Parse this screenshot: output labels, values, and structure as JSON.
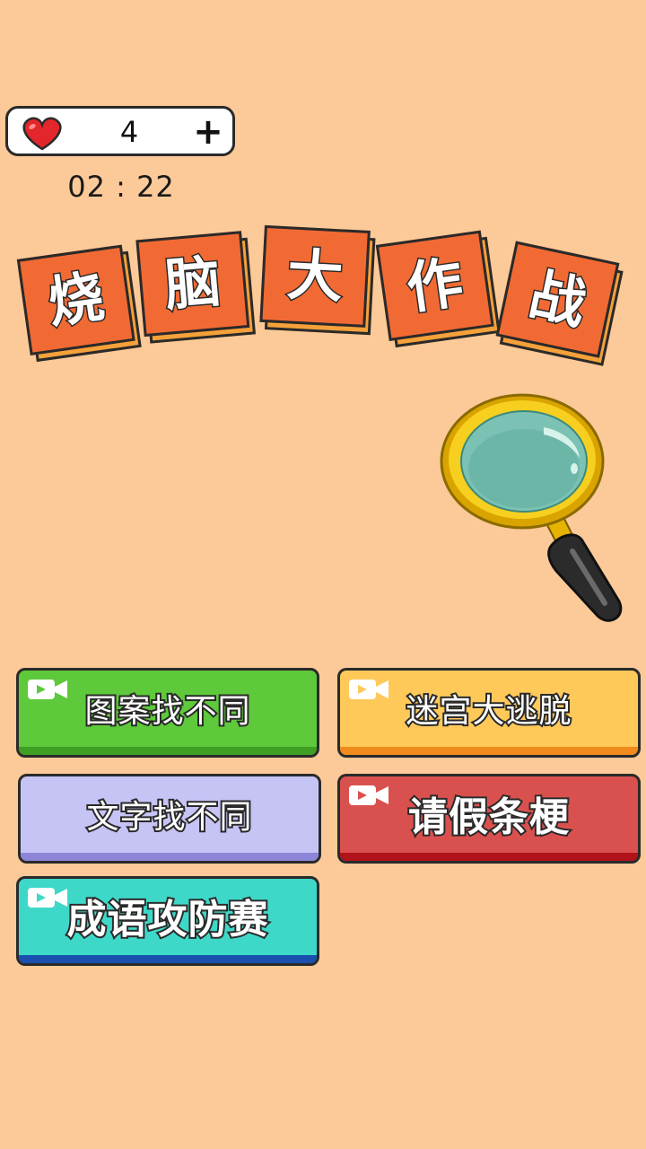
{
  "hud": {
    "lives": "4",
    "add_lives_label": "+",
    "timer": "02 : 22"
  },
  "title": {
    "chars": [
      "烧",
      "脑",
      "大",
      "作",
      "战"
    ]
  },
  "games": [
    {
      "label": "图案找不同",
      "has_video": true,
      "color": "#5ec93b"
    },
    {
      "label": "迷宫大逃脱",
      "has_video": true,
      "color": "#ffc95a"
    },
    {
      "label": "文字找不同",
      "has_video": false,
      "color": "#c6c3f5"
    },
    {
      "label": "请假条梗",
      "has_video": true,
      "color": "#d9514f"
    },
    {
      "label": "成语攻防赛",
      "has_video": true,
      "color": "#3ed8c8"
    }
  ],
  "icons": {
    "lives": "heart-icon",
    "add": "plus-icon",
    "video": "video-camera-icon",
    "decor": "magnifying-glass-icon"
  }
}
